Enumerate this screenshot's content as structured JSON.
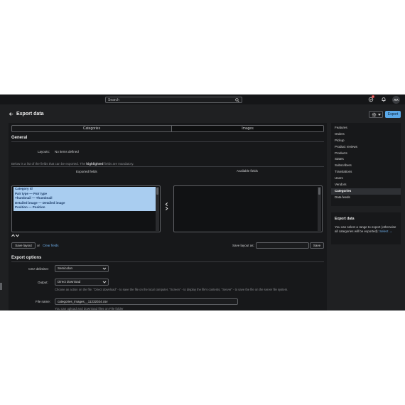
{
  "topbar": {
    "search_placeholder": "Search",
    "notification_count": "2",
    "avatar_initials": "AA"
  },
  "header": {
    "title": "Export data",
    "export_label": "Export"
  },
  "tabs": [
    {
      "label": "Categories"
    },
    {
      "label": "Images"
    }
  ],
  "general": {
    "title": "General",
    "layouts_label": "Layouts:",
    "layouts_value": "No items defined",
    "note_prefix": "Below is a list of the fields that can be exported. The",
    "note_bold": "highlighted",
    "note_suffix": "fields are mandatory.",
    "exported_header": "Exported fields",
    "available_header": "Available fields",
    "exported_fields": [
      "Category id",
      "Pair type — Pair type",
      "Thumbnail — Thumbnail",
      "Detailed image — Detailed image",
      "Position — Position"
    ],
    "save_layout_label": "Save layout",
    "or_label": "or",
    "clear_fields_label": "Clear fields",
    "save_layout_as_label": "Save layout as:",
    "save_label": "Save"
  },
  "export_options": {
    "title": "Export options",
    "csv_delimiter_label": "CSV delimiter:",
    "csv_delimiter_value": "Semicolon",
    "output_label": "Output:",
    "output_value": "Direct download",
    "output_help": "Choose an action on the file: \"Direct download\" - to save the file on the local computer, \"Screen\" - to display the file's contents, \"Server\" - to save the file on the server file system.",
    "file_name_label": "File name:",
    "file_name_value": "categories_images__11232024.csv",
    "file_name_help": "You can upload and download files on File folder"
  },
  "sidebar": {
    "items": [
      {
        "label": "Features",
        "active": false
      },
      {
        "label": "Orders",
        "active": false
      },
      {
        "label": "Pickup",
        "active": false
      },
      {
        "label": "Product reviews",
        "active": false
      },
      {
        "label": "Products",
        "active": false
      },
      {
        "label": "States",
        "active": false
      },
      {
        "label": "Subscribers",
        "active": false
      },
      {
        "label": "Translations",
        "active": false
      },
      {
        "label": "Users",
        "active": false
      },
      {
        "label": "Vendors",
        "active": false
      },
      {
        "label": "Categories",
        "active": true
      },
      {
        "label": "Data feeds",
        "active": false
      }
    ],
    "data_box_title": "Export data",
    "data_box_text": "You can select a range to export (otherwise all categories will be exported):",
    "data_box_link": "Select →"
  },
  "colors": {
    "accent": "#5aa8e8",
    "panel": "#17181a",
    "background": "#1f2022",
    "highlight": "#a9cdf0"
  }
}
